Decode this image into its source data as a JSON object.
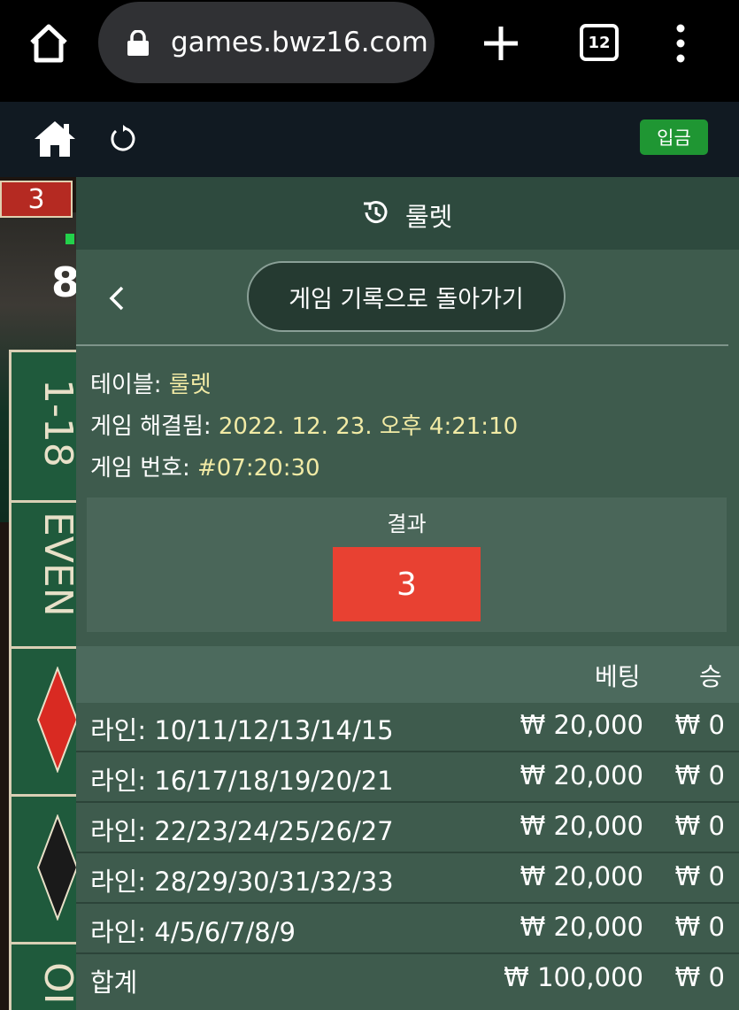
{
  "browser": {
    "url": "games.bwz16.com",
    "tab_count": "12"
  },
  "topbar": {
    "deposit_label": "입금"
  },
  "background": {
    "result_number": "3",
    "partial_number": "8",
    "felt_labels": [
      "1-18",
      "EVEN",
      "OI"
    ]
  },
  "panel": {
    "title": "룰렛",
    "back_label": "게임 기록으로 돌아가기",
    "info": [
      {
        "label": "테이블: ",
        "value": "룰렛"
      },
      {
        "label": "게임 해결됨: ",
        "value": "2022. 12. 23. 오후 4:21:10"
      },
      {
        "label": "게임 번호: ",
        "value": "#07:20:30"
      }
    ],
    "result": {
      "label": "결과",
      "number": "3",
      "color": "#e84132"
    },
    "table": {
      "head_bet": "베팅",
      "head_win": "승",
      "rows": [
        {
          "line": "라인: 10/11/12/13/14/15",
          "bet": "₩ 20,000",
          "win": "₩ 0"
        },
        {
          "line": "라인: 16/17/18/19/20/21",
          "bet": "₩ 20,000",
          "win": "₩ 0"
        },
        {
          "line": "라인: 22/23/24/25/26/27",
          "bet": "₩ 20,000",
          "win": "₩ 0"
        },
        {
          "line": "라인: 28/29/30/31/32/33",
          "bet": "₩ 20,000",
          "win": "₩ 0"
        },
        {
          "line": "라인: 4/5/6/7/8/9",
          "bet": "₩ 20,000",
          "win": "₩ 0"
        }
      ],
      "total": {
        "line": "합계",
        "bet": "₩ 100,000",
        "win": "₩ 0"
      }
    }
  }
}
